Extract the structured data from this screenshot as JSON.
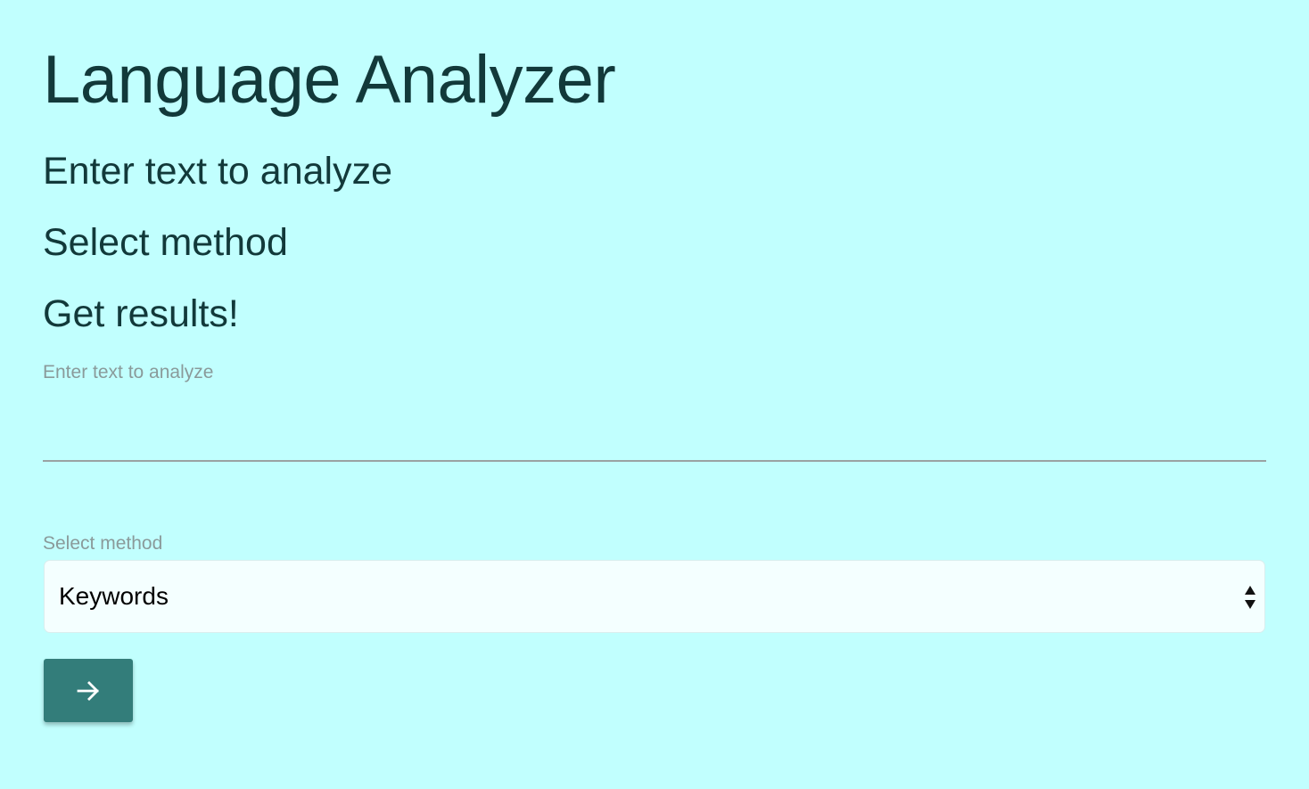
{
  "header": {
    "title": "Language Analyzer"
  },
  "steps": [
    "Enter text to analyze",
    "Select method",
    "Get results!"
  ],
  "form": {
    "text_field": {
      "label": "Enter text to analyze",
      "value": ""
    },
    "method_select": {
      "label": "Select method",
      "selected": "Keywords"
    },
    "submit_button": {
      "icon": "arrow-right-icon"
    }
  },
  "colors": {
    "background": "#c1fffe",
    "text": "#12393a",
    "label": "#8a9a9a",
    "button": "#337d7a",
    "select_background": "#f4ffff"
  }
}
